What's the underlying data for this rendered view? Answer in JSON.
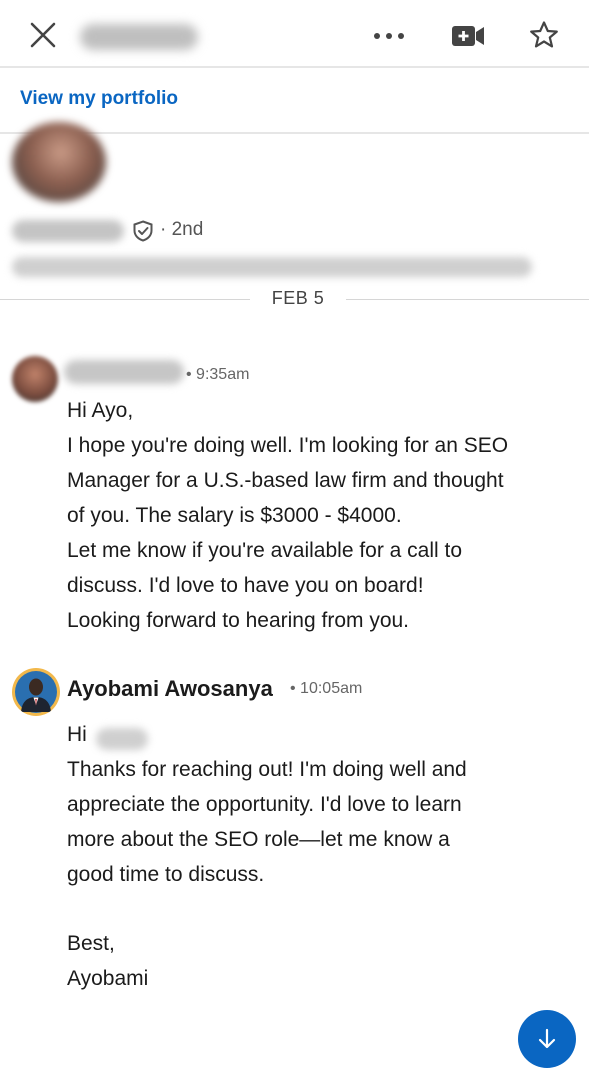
{
  "header": {
    "close_icon": "close-icon",
    "more_icon": "more-horizontal-icon",
    "video_icon": "video-call-icon",
    "star_icon": "star-icon"
  },
  "profile": {
    "portfolio_link": "View my portfolio",
    "degree": "· 2nd",
    "verified_icon": "shield-check-icon"
  },
  "date_divider": "FEB 5",
  "messages": [
    {
      "timestamp": "9:35am",
      "lines": [
        "Hi Ayo,",
        "I hope you're doing well. I'm looking for an SEO",
        "Manager for a U.S.-based law firm and thought",
        "of you. The salary is $3000 - $4000.",
        "Let me know if you're available for a call to",
        "discuss. I'd love to have you on board!",
        "Looking forward to hearing from you."
      ]
    },
    {
      "sender": "Ayobami Awosanya",
      "timestamp": "10:05am",
      "lines": [
        "Hi",
        "Thanks for reaching out! I'm doing well and",
        "appreciate the opportunity. I'd love to learn",
        "more about the SEO role—let me know a",
        "good time to discuss.",
        "Best,",
        "Ayobami"
      ]
    }
  ],
  "scroll_button_icon": "arrow-down-icon",
  "colors": {
    "accent": "#0a66c2",
    "avatar_ring": "#f2b84b"
  }
}
